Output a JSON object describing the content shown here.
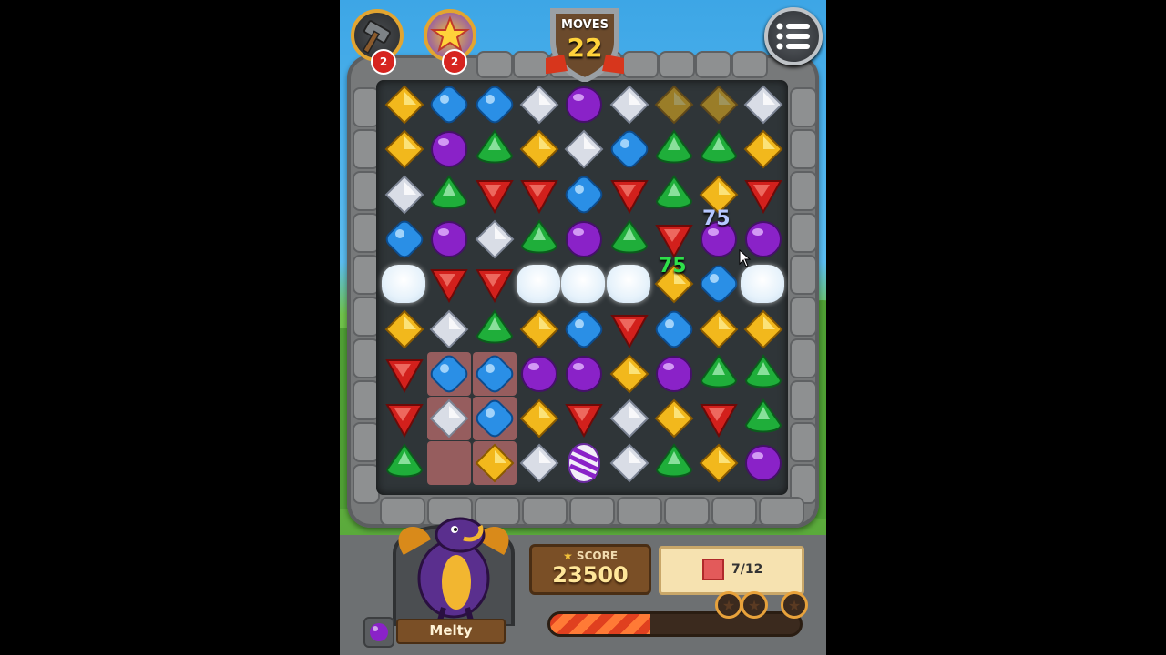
{
  "hud": {
    "moves_label": "MOVES",
    "moves_value": "22",
    "boosters": [
      {
        "name": "hammer",
        "count": "2"
      },
      {
        "name": "star-swap",
        "count": "2"
      }
    ],
    "menu_icon": "hamburger-menu-icon"
  },
  "score": {
    "label": "SCORE",
    "value": "23500",
    "icon": "trophy-icon"
  },
  "goal": {
    "icon": "red-tile-icon",
    "text": "7/12"
  },
  "progress": {
    "fraction": 0.4,
    "stars_earned": 0,
    "stars_total": 3
  },
  "pet": {
    "name": "Melty",
    "color": "purple"
  },
  "floating_points": [
    "75",
    "75"
  ],
  "colors": {
    "yellow": "#f2b81c",
    "blue": "#2a8fe6",
    "white": "#d9dde6",
    "purple": "#8a22c8",
    "green": "#1fae3a",
    "red": "#d2201c"
  },
  "board": [
    [
      "Y",
      "B",
      "B",
      "W",
      "P",
      "W",
      "y",
      "y",
      "W"
    ],
    [
      "Y",
      "P",
      "G",
      "Y",
      "W",
      "B",
      "G",
      "G",
      "Y"
    ],
    [
      "W",
      "G",
      "R",
      "R",
      "B",
      "R",
      "G",
      "Y",
      "R"
    ],
    [
      "B",
      "P",
      "W",
      "G",
      "P",
      "G",
      "R",
      "P",
      "P"
    ],
    [
      "C",
      "R",
      "R",
      "C",
      "C",
      "C",
      "Y",
      "B",
      "C"
    ],
    [
      "Y",
      "W",
      "G",
      "Y",
      "B",
      "R",
      "B",
      "Y",
      "Y"
    ],
    [
      "R",
      "B",
      "B",
      "P",
      "P",
      "Y",
      "P",
      "G",
      "G"
    ],
    [
      "R",
      "W",
      "B",
      "Y",
      "R",
      "W",
      "Y",
      "R",
      "G"
    ],
    [
      "G",
      "r",
      "Y",
      "W",
      "S",
      "W",
      "G",
      "Y",
      "P"
    ]
  ]
}
